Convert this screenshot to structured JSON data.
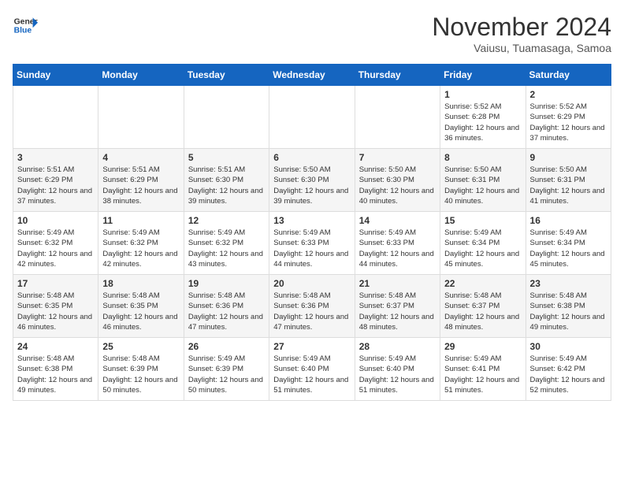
{
  "header": {
    "logo_line1": "General",
    "logo_line2": "Blue",
    "month": "November 2024",
    "location": "Vaiusu, Tuamasaga, Samoa"
  },
  "weekdays": [
    "Sunday",
    "Monday",
    "Tuesday",
    "Wednesday",
    "Thursday",
    "Friday",
    "Saturday"
  ],
  "weeks": [
    [
      {
        "day": "",
        "info": ""
      },
      {
        "day": "",
        "info": ""
      },
      {
        "day": "",
        "info": ""
      },
      {
        "day": "",
        "info": ""
      },
      {
        "day": "",
        "info": ""
      },
      {
        "day": "1",
        "info": "Sunrise: 5:52 AM\nSunset: 6:28 PM\nDaylight: 12 hours and 36 minutes."
      },
      {
        "day": "2",
        "info": "Sunrise: 5:52 AM\nSunset: 6:29 PM\nDaylight: 12 hours and 37 minutes."
      }
    ],
    [
      {
        "day": "3",
        "info": "Sunrise: 5:51 AM\nSunset: 6:29 PM\nDaylight: 12 hours and 37 minutes."
      },
      {
        "day": "4",
        "info": "Sunrise: 5:51 AM\nSunset: 6:29 PM\nDaylight: 12 hours and 38 minutes."
      },
      {
        "day": "5",
        "info": "Sunrise: 5:51 AM\nSunset: 6:30 PM\nDaylight: 12 hours and 39 minutes."
      },
      {
        "day": "6",
        "info": "Sunrise: 5:50 AM\nSunset: 6:30 PM\nDaylight: 12 hours and 39 minutes."
      },
      {
        "day": "7",
        "info": "Sunrise: 5:50 AM\nSunset: 6:30 PM\nDaylight: 12 hours and 40 minutes."
      },
      {
        "day": "8",
        "info": "Sunrise: 5:50 AM\nSunset: 6:31 PM\nDaylight: 12 hours and 40 minutes."
      },
      {
        "day": "9",
        "info": "Sunrise: 5:50 AM\nSunset: 6:31 PM\nDaylight: 12 hours and 41 minutes."
      }
    ],
    [
      {
        "day": "10",
        "info": "Sunrise: 5:49 AM\nSunset: 6:32 PM\nDaylight: 12 hours and 42 minutes."
      },
      {
        "day": "11",
        "info": "Sunrise: 5:49 AM\nSunset: 6:32 PM\nDaylight: 12 hours and 42 minutes."
      },
      {
        "day": "12",
        "info": "Sunrise: 5:49 AM\nSunset: 6:32 PM\nDaylight: 12 hours and 43 minutes."
      },
      {
        "day": "13",
        "info": "Sunrise: 5:49 AM\nSunset: 6:33 PM\nDaylight: 12 hours and 44 minutes."
      },
      {
        "day": "14",
        "info": "Sunrise: 5:49 AM\nSunset: 6:33 PM\nDaylight: 12 hours and 44 minutes."
      },
      {
        "day": "15",
        "info": "Sunrise: 5:49 AM\nSunset: 6:34 PM\nDaylight: 12 hours and 45 minutes."
      },
      {
        "day": "16",
        "info": "Sunrise: 5:49 AM\nSunset: 6:34 PM\nDaylight: 12 hours and 45 minutes."
      }
    ],
    [
      {
        "day": "17",
        "info": "Sunrise: 5:48 AM\nSunset: 6:35 PM\nDaylight: 12 hours and 46 minutes."
      },
      {
        "day": "18",
        "info": "Sunrise: 5:48 AM\nSunset: 6:35 PM\nDaylight: 12 hours and 46 minutes."
      },
      {
        "day": "19",
        "info": "Sunrise: 5:48 AM\nSunset: 6:36 PM\nDaylight: 12 hours and 47 minutes."
      },
      {
        "day": "20",
        "info": "Sunrise: 5:48 AM\nSunset: 6:36 PM\nDaylight: 12 hours and 47 minutes."
      },
      {
        "day": "21",
        "info": "Sunrise: 5:48 AM\nSunset: 6:37 PM\nDaylight: 12 hours and 48 minutes."
      },
      {
        "day": "22",
        "info": "Sunrise: 5:48 AM\nSunset: 6:37 PM\nDaylight: 12 hours and 48 minutes."
      },
      {
        "day": "23",
        "info": "Sunrise: 5:48 AM\nSunset: 6:38 PM\nDaylight: 12 hours and 49 minutes."
      }
    ],
    [
      {
        "day": "24",
        "info": "Sunrise: 5:48 AM\nSunset: 6:38 PM\nDaylight: 12 hours and 49 minutes."
      },
      {
        "day": "25",
        "info": "Sunrise: 5:48 AM\nSunset: 6:39 PM\nDaylight: 12 hours and 50 minutes."
      },
      {
        "day": "26",
        "info": "Sunrise: 5:49 AM\nSunset: 6:39 PM\nDaylight: 12 hours and 50 minutes."
      },
      {
        "day": "27",
        "info": "Sunrise: 5:49 AM\nSunset: 6:40 PM\nDaylight: 12 hours and 51 minutes."
      },
      {
        "day": "28",
        "info": "Sunrise: 5:49 AM\nSunset: 6:40 PM\nDaylight: 12 hours and 51 minutes."
      },
      {
        "day": "29",
        "info": "Sunrise: 5:49 AM\nSunset: 6:41 PM\nDaylight: 12 hours and 51 minutes."
      },
      {
        "day": "30",
        "info": "Sunrise: 5:49 AM\nSunset: 6:42 PM\nDaylight: 12 hours and 52 minutes."
      }
    ]
  ]
}
